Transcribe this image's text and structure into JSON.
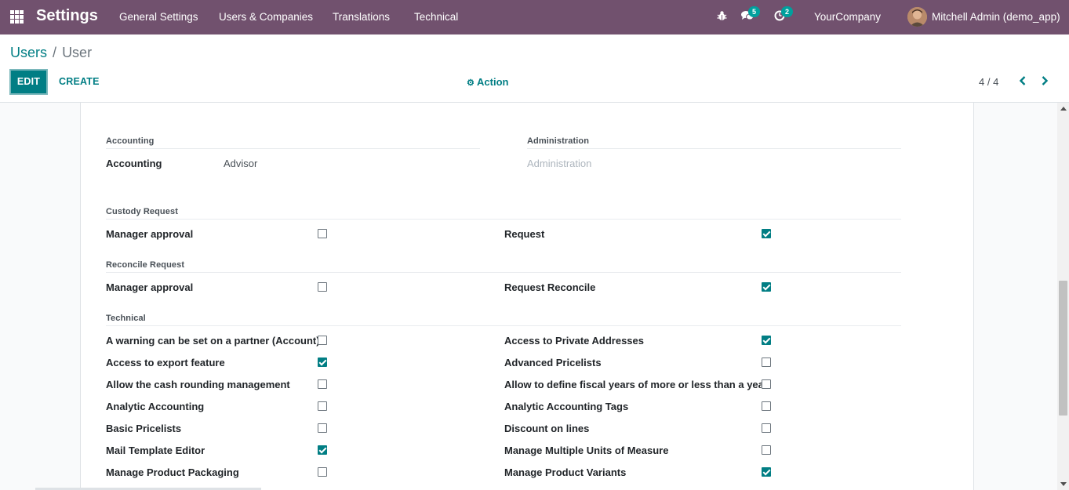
{
  "navbar": {
    "app_title": "Settings",
    "menu": [
      "General Settings",
      "Users & Companies",
      "Translations",
      "Technical"
    ],
    "messages_count": "5",
    "activities_count": "2",
    "company": "YourCompany",
    "user": "Mitchell Admin (demo_app)"
  },
  "breadcrumb": {
    "parent": "Users",
    "separator": "/",
    "current": "User"
  },
  "buttons": {
    "edit": "EDIT",
    "create": "CREATE",
    "action": "Action"
  },
  "pager": {
    "value": "4 / 4"
  },
  "groups": {
    "accounting": {
      "title": "Accounting",
      "label": "Accounting",
      "value": "Advisor"
    },
    "administration": {
      "title": "Administration",
      "placeholder": "Administration"
    },
    "custody": {
      "title": "Custody Request",
      "left": {
        "label": "Manager approval",
        "checked": false
      },
      "right": {
        "label": "Request",
        "checked": true
      }
    },
    "reconcile": {
      "title": "Reconcile Request",
      "left": {
        "label": "Manager approval",
        "checked": false
      },
      "right": {
        "label": "Request Reconcile",
        "checked": true
      }
    },
    "technical": {
      "title": "Technical",
      "left": [
        {
          "label": "A warning can be set on a partner (Account)",
          "checked": false
        },
        {
          "label": "Access to export feature",
          "checked": true
        },
        {
          "label": "Allow the cash rounding management",
          "checked": false
        },
        {
          "label": "Analytic Accounting",
          "checked": false
        },
        {
          "label": "Basic Pricelists",
          "checked": false
        },
        {
          "label": "Mail Template Editor",
          "checked": true
        },
        {
          "label": "Manage Product Packaging",
          "checked": false
        }
      ],
      "right": [
        {
          "label": "Access to Private Addresses",
          "checked": true
        },
        {
          "label": "Advanced Pricelists",
          "checked": false
        },
        {
          "label": "Allow to define fiscal years of more or less than a year",
          "checked": false
        },
        {
          "label": "Analytic Accounting Tags",
          "checked": false
        },
        {
          "label": "Discount on lines",
          "checked": false
        },
        {
          "label": "Manage Multiple Units of Measure",
          "checked": false
        },
        {
          "label": "Manage Product Variants",
          "checked": true
        }
      ]
    }
  },
  "colors": {
    "navbar": "#71516e",
    "primary": "#017e84",
    "badge": "#00a09d"
  }
}
